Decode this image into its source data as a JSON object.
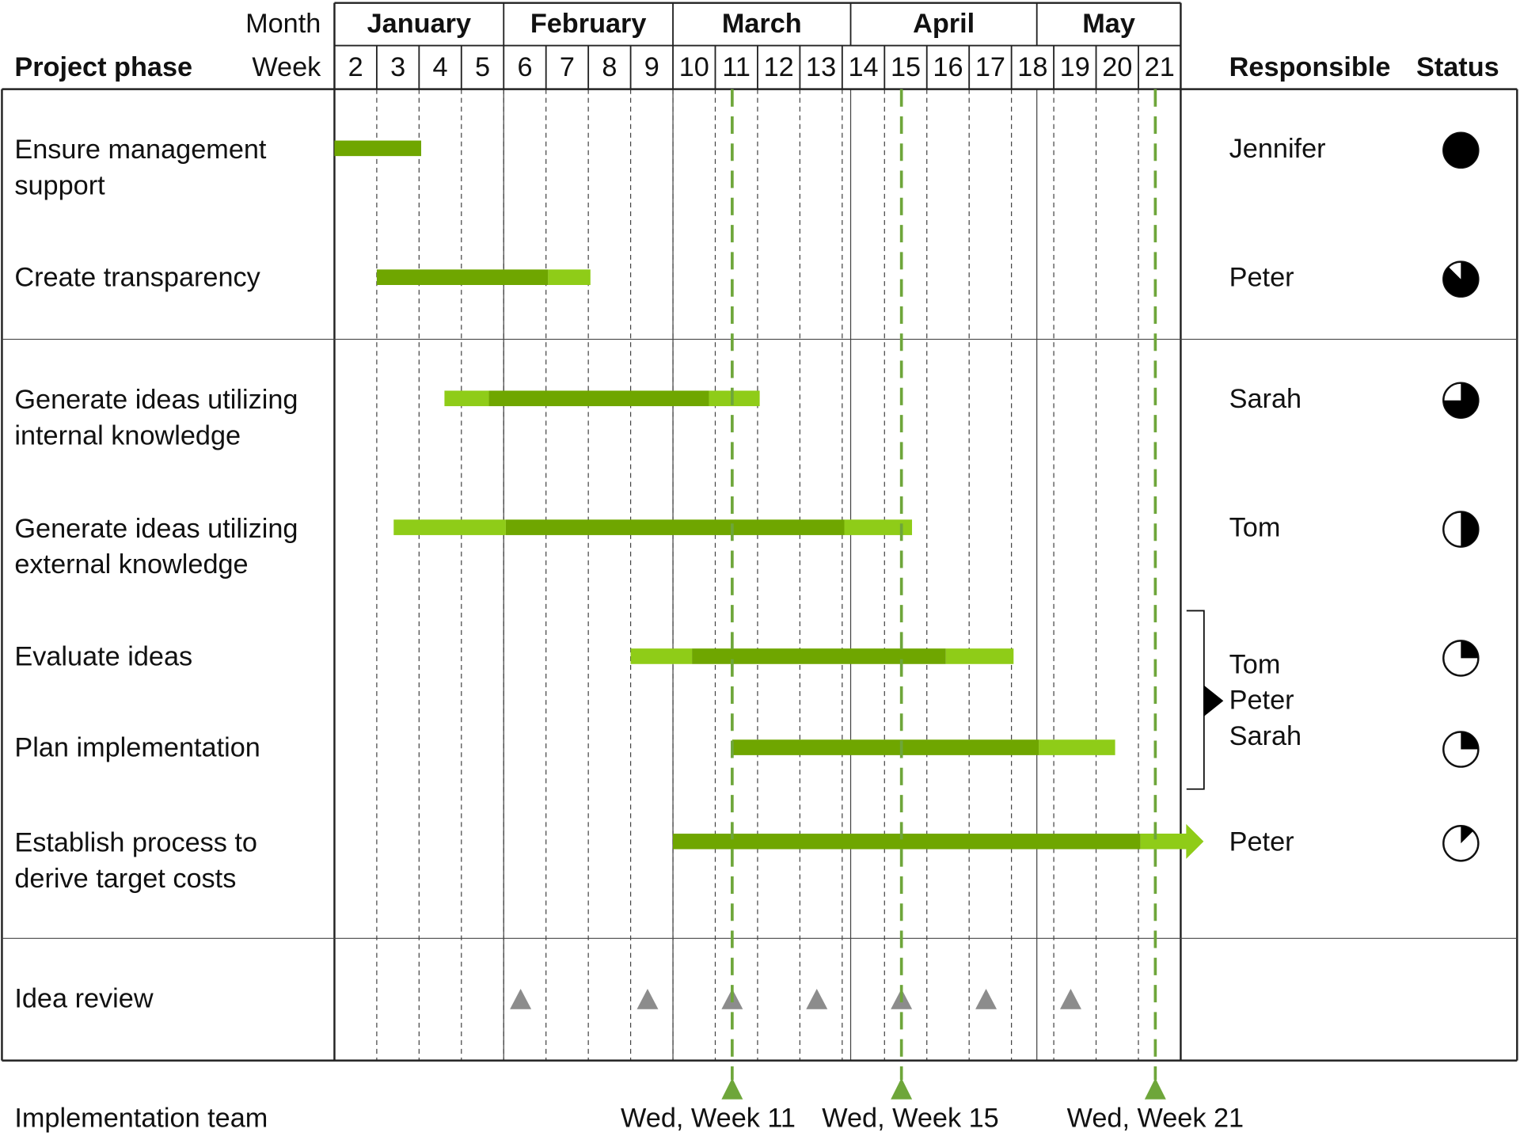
{
  "chart_data": {
    "type": "gantt",
    "title": "",
    "header": {
      "month_label": "Month",
      "week_label": "Week",
      "phase_label": "Project phase",
      "responsible_label": "Responsible",
      "status_label": "Status"
    },
    "weeks": [
      2,
      3,
      4,
      5,
      6,
      7,
      8,
      9,
      10,
      11,
      12,
      13,
      14,
      15,
      16,
      17,
      18,
      19,
      20,
      21
    ],
    "months": [
      {
        "name": "January",
        "start": 2,
        "end": 6
      },
      {
        "name": "February",
        "start": 6,
        "end": 10
      },
      {
        "name": "March",
        "start": 10,
        "end": 14.2
      },
      {
        "name": "April",
        "start": 14.2,
        "end": 18.6
      },
      {
        "name": "May",
        "start": 18.6,
        "end": 22
      }
    ],
    "month_separators": [
      6,
      10,
      14.2,
      18.6
    ],
    "tasks": [
      {
        "name": "Ensure management support",
        "lines": [
          "Ensure management",
          "support"
        ],
        "responsible": [
          "Jennifer"
        ],
        "status": 1.0,
        "segments": [
          {
            "start": 2,
            "end": 4.05,
            "kind": "core"
          }
        ]
      },
      {
        "name": "Create transparency",
        "lines": [
          "Create transparency"
        ],
        "responsible": [
          "Peter"
        ],
        "status": 0.875,
        "segments": [
          {
            "start": 3,
            "end": 7.05,
            "kind": "core"
          },
          {
            "start": 7.05,
            "end": 8.05,
            "kind": "buffer"
          }
        ]
      },
      {
        "name": "Generate ideas utilizing internal knowledge",
        "lines": [
          "Generate ideas utilizing",
          "internal knowledge"
        ],
        "responsible": [
          "Sarah"
        ],
        "status": 0.75,
        "segments": [
          {
            "start": 4.6,
            "end": 5.65,
            "kind": "buffer"
          },
          {
            "start": 5.65,
            "end": 10.85,
            "kind": "core"
          },
          {
            "start": 10.85,
            "end": 12.05,
            "kind": "buffer"
          }
        ]
      },
      {
        "name": "Generate ideas utilizing external knowledge",
        "lines": [
          "Generate ideas utilizing",
          "external knowledge"
        ],
        "responsible": [
          "Tom"
        ],
        "status": 0.5,
        "segments": [
          {
            "start": 3.4,
            "end": 6.05,
            "kind": "buffer"
          },
          {
            "start": 6.05,
            "end": 14.05,
            "kind": "core"
          },
          {
            "start": 14.05,
            "end": 15.65,
            "kind": "buffer"
          }
        ]
      },
      {
        "name": "Evaluate ideas",
        "lines": [
          "Evaluate ideas"
        ],
        "responsible": [],
        "status": 0.25,
        "segments": [
          {
            "start": 9.0,
            "end": 10.45,
            "kind": "buffer"
          },
          {
            "start": 10.45,
            "end": 16.45,
            "kind": "core"
          },
          {
            "start": 16.45,
            "end": 18.05,
            "kind": "buffer"
          }
        ]
      },
      {
        "name": "Plan implementation",
        "lines": [
          "Plan implementation"
        ],
        "responsible": [],
        "status": 0.25,
        "segments": [
          {
            "start": 11.4,
            "end": 18.65,
            "kind": "core"
          },
          {
            "start": 18.65,
            "end": 20.45,
            "kind": "buffer"
          }
        ]
      },
      {
        "name": "Establish process to derive target costs",
        "lines": [
          "Establish process to",
          "derive target costs"
        ],
        "responsible": [
          "Peter"
        ],
        "status": 0.125,
        "segments": [
          {
            "start": 10.0,
            "end": 21.05,
            "kind": "core"
          },
          {
            "start": 21.05,
            "end": 22.45,
            "kind": "buffer-arrow"
          }
        ]
      }
    ],
    "group_responsible": {
      "tasks": [
        "Evaluate ideas",
        "Plan implementation"
      ],
      "names": [
        "Tom",
        "Peter",
        "Sarah"
      ]
    },
    "idea_review": {
      "label": "Idea review",
      "weeks": [
        6.4,
        9.4,
        11.4,
        13.4,
        15.4,
        17.4,
        19.4
      ]
    },
    "milestones": {
      "label": "Implementation team",
      "items": [
        {
          "week": 11.4,
          "label": "Wed, Week 11"
        },
        {
          "week": 15.4,
          "label": "Wed, Week 15"
        },
        {
          "week": 21.4,
          "label": "Wed, Week 21"
        }
      ]
    },
    "colors": {
      "core": "#6fa600",
      "buffer": "#8fcc18",
      "milestone_line": "#6ea63a",
      "review_marker": "#8c8c8c",
      "grid": "#333333"
    }
  }
}
